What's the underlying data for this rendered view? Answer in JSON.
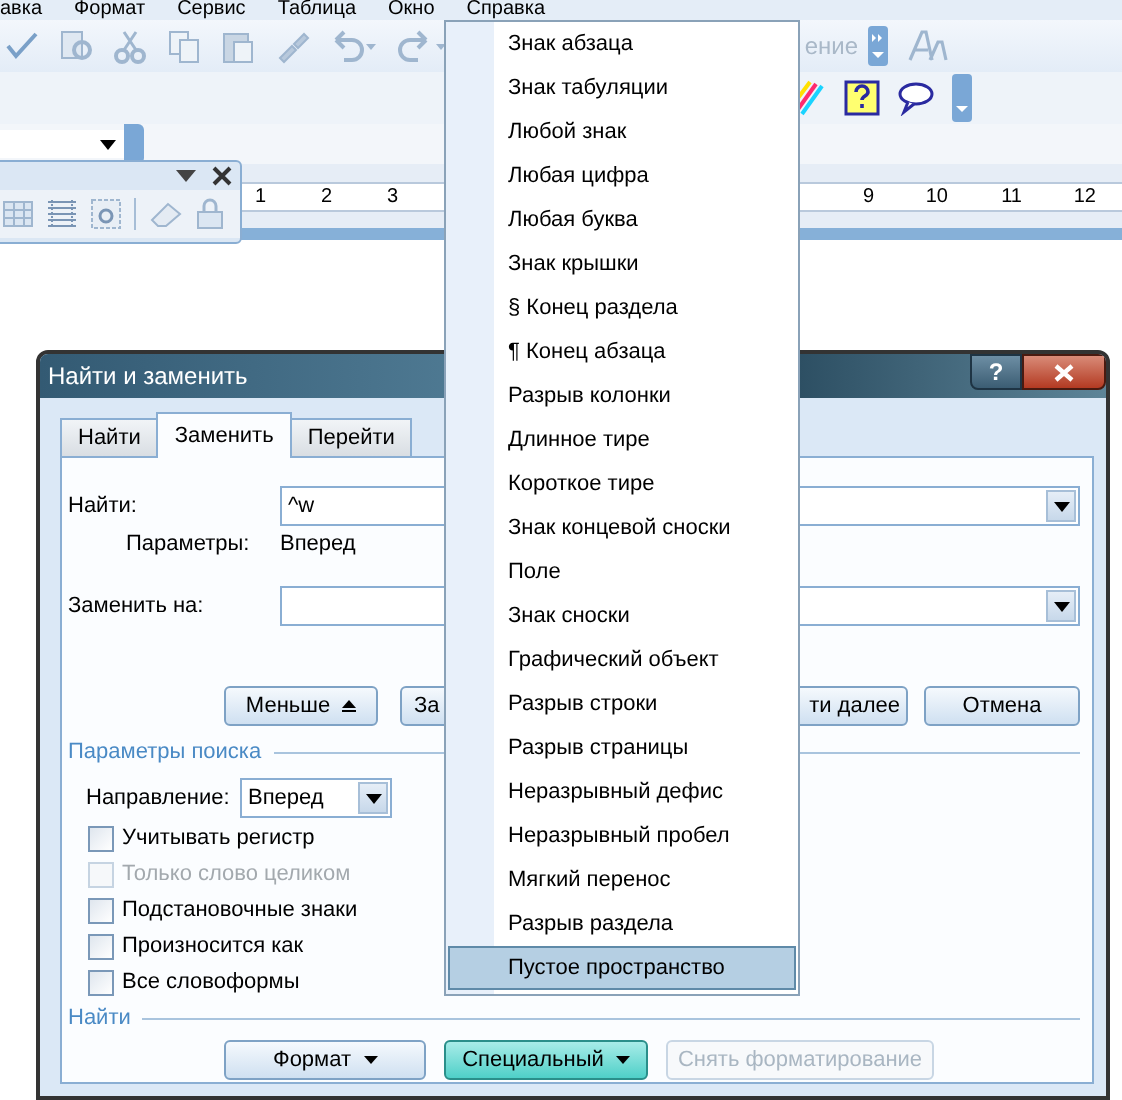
{
  "menubar": [
    "авка",
    "Формат",
    "Сервис",
    "Таблица",
    "Окно",
    "Справка"
  ],
  "toolbar": {
    "style_box_text": "ение"
  },
  "ruler": {
    "left_numbers": [
      "1",
      "2",
      "3"
    ],
    "right_numbers": [
      "9",
      "10",
      "11",
      "12"
    ]
  },
  "dialog": {
    "title": "Найти и заменить",
    "help_button": "?",
    "tabs": [
      {
        "label": "Найти",
        "selected": false
      },
      {
        "label": "Заменить",
        "selected": true
      },
      {
        "label": "Перейти",
        "selected": false
      }
    ],
    "find": {
      "label": "Найти:",
      "value": "^w",
      "options_label": "Параметры:",
      "options_value": "Вперед"
    },
    "replace": {
      "label": "Заменить на:"
    },
    "action_buttons": [
      {
        "label": "Меньше",
        "kind": "collapse"
      },
      {
        "label": "За",
        "kind": "cut-right"
      },
      {
        "label": "ти далее",
        "kind": "cut-left"
      },
      {
        "label": "Отмена",
        "kind": "plain"
      }
    ],
    "search_options": {
      "title": "Параметры поиска",
      "direction_label": "Направление:",
      "direction_value": "Вперед",
      "checkboxes": [
        {
          "label": "Учитывать регистр",
          "checked": false,
          "disabled": false
        },
        {
          "label": "Только слово целиком",
          "checked": false,
          "disabled": true
        },
        {
          "label": "Подстановочные знаки",
          "checked": false,
          "disabled": false
        },
        {
          "label": "Произносится как",
          "checked": false,
          "disabled": false
        },
        {
          "label": "Все словоформы",
          "checked": false,
          "disabled": false
        }
      ]
    },
    "find_section": {
      "title": "Найти",
      "buttons": [
        {
          "label": "Формат",
          "dropdown": true,
          "pressed": false,
          "disabled": false
        },
        {
          "label": "Специальный",
          "dropdown": true,
          "pressed": true,
          "disabled": false
        },
        {
          "label": "Снять форматирование",
          "dropdown": false,
          "pressed": false,
          "disabled": true
        }
      ]
    }
  },
  "special_menu": {
    "items": [
      {
        "label": "Знак абзаца",
        "selected": false
      },
      {
        "label": "Знак табуляции",
        "selected": false
      },
      {
        "label": "Любой знак",
        "selected": false
      },
      {
        "label": "Любая цифра",
        "selected": false
      },
      {
        "label": "Любая буква",
        "selected": false
      },
      {
        "label": "Знак крышки",
        "selected": false
      },
      {
        "label": "§ Конец раздела",
        "selected": false
      },
      {
        "label": "¶ Конец абзаца",
        "selected": false
      },
      {
        "label": "Разрыв колонки",
        "selected": false
      },
      {
        "label": "Длинное тире",
        "selected": false
      },
      {
        "label": "Короткое тире",
        "selected": false
      },
      {
        "label": "Знак концевой сноски",
        "selected": false
      },
      {
        "label": "Поле",
        "selected": false
      },
      {
        "label": "Знак сноски",
        "selected": false
      },
      {
        "label": "Графический объект",
        "selected": false
      },
      {
        "label": "Разрыв строки",
        "selected": false
      },
      {
        "label": "Разрыв страницы",
        "selected": false
      },
      {
        "label": "Неразрывный дефис",
        "selected": false
      },
      {
        "label": "Неразрывный пробел",
        "selected": false
      },
      {
        "label": "Мягкий перенос",
        "selected": false
      },
      {
        "label": "Разрыв раздела",
        "selected": false
      },
      {
        "label": "Пустое пространство",
        "selected": true
      }
    ]
  }
}
